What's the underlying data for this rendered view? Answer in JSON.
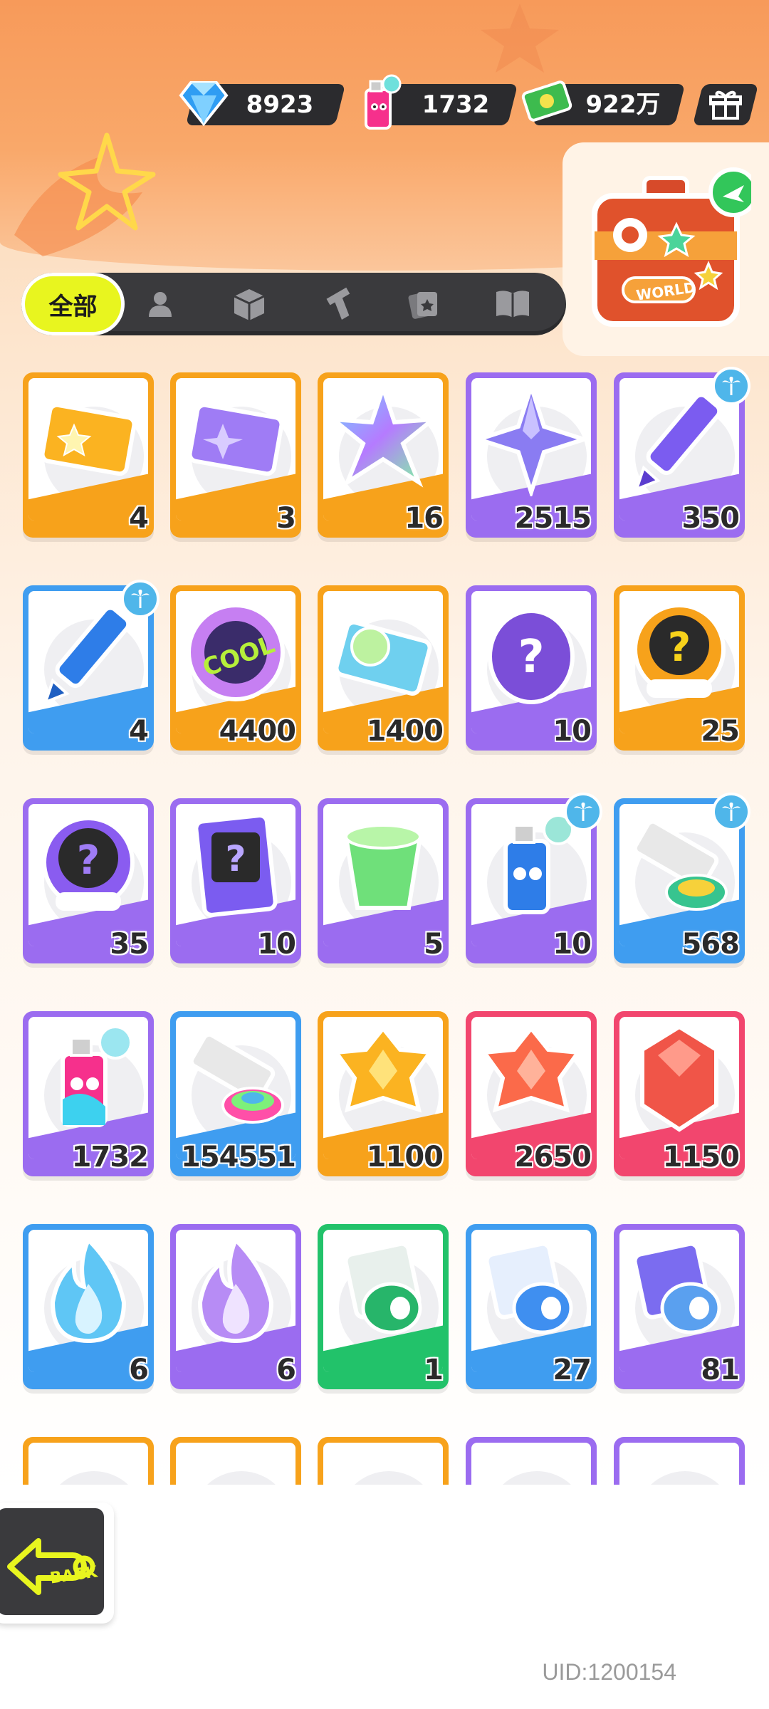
{
  "currencies": [
    {
      "name": "diamond",
      "value": "8923"
    },
    {
      "name": "spray-can",
      "value": "1732"
    },
    {
      "name": "cash",
      "value": "922万"
    }
  ],
  "tabs": {
    "all_label": "全部",
    "icons": [
      "person-icon",
      "box-icon",
      "gun-icon",
      "card-icon",
      "book-icon"
    ]
  },
  "world_badge_label": "WORLD",
  "items": [
    {
      "qty": "4",
      "color": "#f7a21b",
      "icon": "gold-ticket-icon"
    },
    {
      "qty": "3",
      "color": "#f7a21b",
      "icon": "purple-ticket-icon"
    },
    {
      "qty": "16",
      "color": "#f7a21b",
      "icon": "rainbow-star-icon"
    },
    {
      "qty": "2515",
      "color": "#9b6cf0",
      "icon": "purple-star-icon"
    },
    {
      "qty": "350",
      "color": "#9b6cf0",
      "icon": "purple-crayon-icon",
      "badge": true
    },
    {
      "qty": "4",
      "color": "#3f9df0",
      "icon": "blue-crayon-icon",
      "badge": true
    },
    {
      "qty": "4400",
      "color": "#f7a21b",
      "icon": "cool-sticker-icon"
    },
    {
      "qty": "1400",
      "color": "#f7a21b",
      "icon": "season-ticket-icon"
    },
    {
      "qty": "10",
      "color": "#9b6cf0",
      "icon": "mystery-egg-icon"
    },
    {
      "qty": "25",
      "color": "#f7a21b",
      "icon": "deity-mystery-badge-icon"
    },
    {
      "qty": "35",
      "color": "#9b6cf0",
      "icon": "deity-mystery-purple-icon"
    },
    {
      "qty": "10",
      "color": "#9b6cf0",
      "icon": "travel-card-icon"
    },
    {
      "qty": "5",
      "color": "#9b6cf0",
      "icon": "green-cup-icon"
    },
    {
      "qty": "10",
      "color": "#9b6cf0",
      "icon": "blue-spray-icon",
      "badge": true
    },
    {
      "qty": "568",
      "color": "#3f9df0",
      "icon": "paint-tube-icon",
      "badge": true
    },
    {
      "qty": "1732",
      "color": "#9b6cf0",
      "icon": "pink-spray-icon"
    },
    {
      "qty": "154551",
      "color": "#3f9df0",
      "icon": "rainbow-paint-tube-icon"
    },
    {
      "qty": "1100",
      "color": "#f7a21b",
      "icon": "yellow-gem-icon"
    },
    {
      "qty": "2650",
      "color": "#f2466e",
      "icon": "orange-gem-icon"
    },
    {
      "qty": "1150",
      "color": "#f2466e",
      "icon": "red-crystal-icon"
    },
    {
      "qty": "6",
      "color": "#3f9df0",
      "icon": "blue-flame-icon"
    },
    {
      "qty": "6",
      "color": "#9b6cf0",
      "icon": "purple-flame-icon"
    },
    {
      "qty": "1",
      "color": "#22c26a",
      "icon": "green-tape-icon"
    },
    {
      "qty": "27",
      "color": "#3f9df0",
      "icon": "blue-tape-icon"
    },
    {
      "qty": "81",
      "color": "#9b6cf0",
      "icon": "purple-tape-icon"
    },
    {
      "qty": "",
      "color": "#f7a21b",
      "icon": "partial-item-icon"
    },
    {
      "qty": "",
      "color": "#f7a21b",
      "icon": "partial-item-icon"
    },
    {
      "qty": "",
      "color": "#f7a21b",
      "icon": "partial-item-icon"
    },
    {
      "qty": "",
      "color": "#9b6cf0",
      "icon": "partial-item-icon"
    },
    {
      "qty": "",
      "color": "#9b6cf0",
      "icon": "partial-item-icon"
    }
  ],
  "back_label": "BACK",
  "uid": "UID:1200154"
}
